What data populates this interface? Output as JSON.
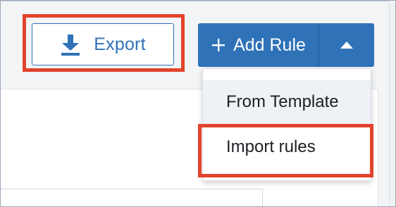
{
  "toolbar": {
    "export_label": "Export",
    "add_rule_label": "Add Rule"
  },
  "dropdown": {
    "items": [
      {
        "label": "From Template"
      },
      {
        "label": "Import rules"
      }
    ]
  },
  "colors": {
    "accent": "#2f72b8",
    "highlight": "#e2432c"
  },
  "icons": {
    "export": "download-icon",
    "add": "plus-icon",
    "toggle": "caret-up-icon"
  }
}
